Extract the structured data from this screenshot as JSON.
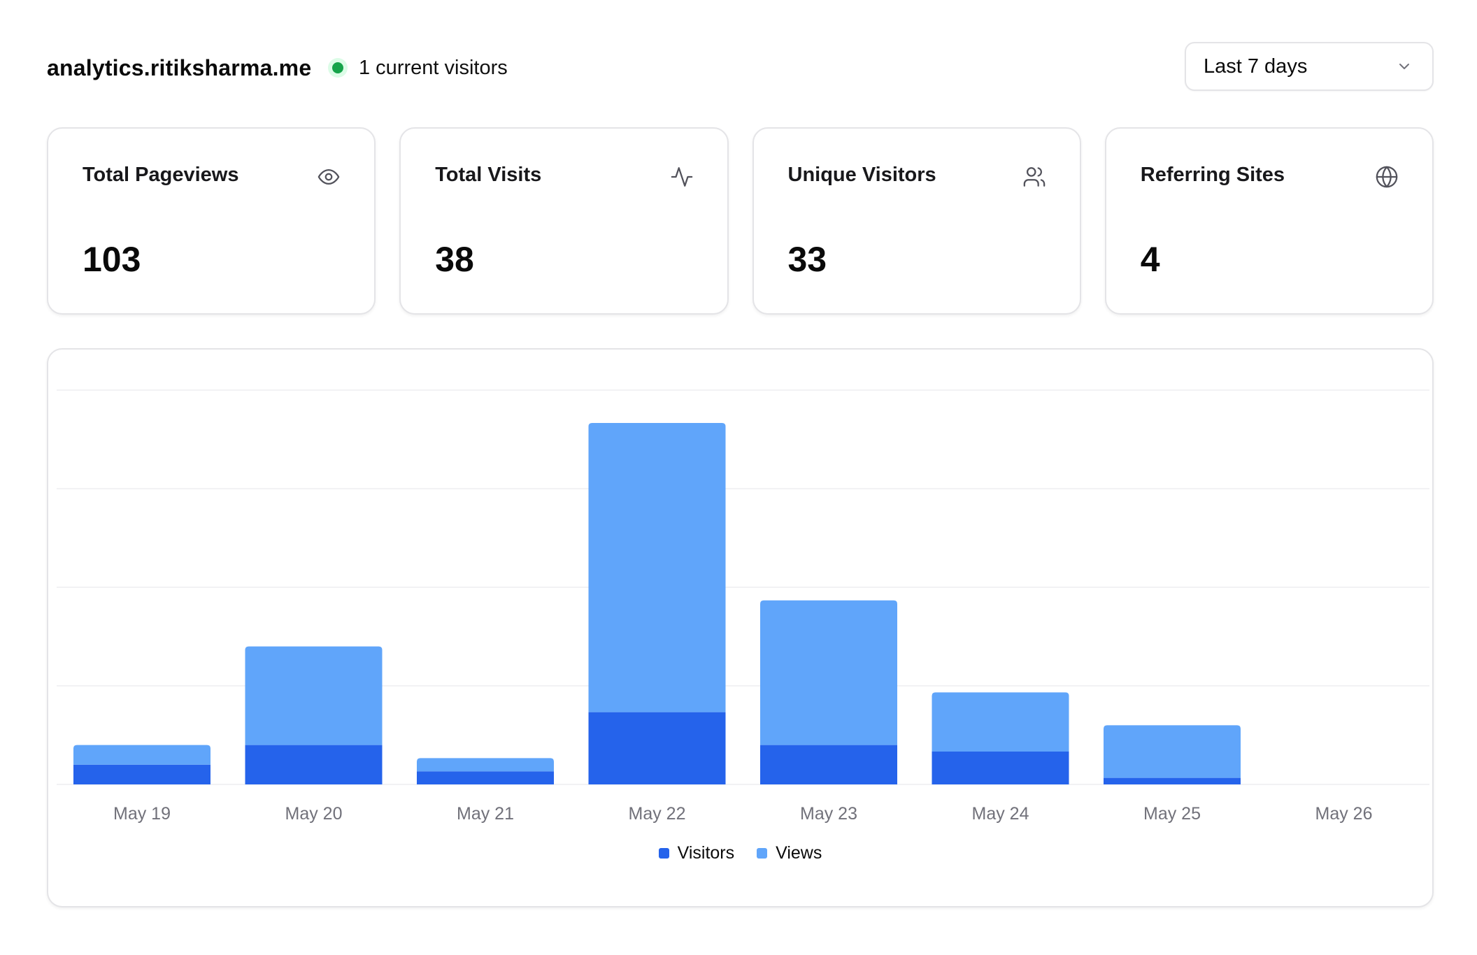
{
  "header": {
    "site_name": "analytics.ritiksharma.me",
    "live_visitors_text": "1 current visitors",
    "live_dot_color": "#16a34a",
    "range_select": {
      "value": "Last 7 days",
      "icon": "chevron-down-icon"
    }
  },
  "stats": [
    {
      "title": "Total Pageviews",
      "value": "103",
      "icon": "eye-icon"
    },
    {
      "title": "Total Visits",
      "value": "38",
      "icon": "activity-icon"
    },
    {
      "title": "Unique Visitors",
      "value": "33",
      "icon": "users-icon"
    },
    {
      "title": "Referring Sites",
      "value": "4",
      "icon": "globe-icon"
    }
  ],
  "chart_data": {
    "type": "bar",
    "stacked": true,
    "categories": [
      "May 19",
      "May 20",
      "May 21",
      "May 22",
      "May 23",
      "May 24",
      "May 25",
      "May 26"
    ],
    "series": [
      {
        "name": "Visitors",
        "color": "#2563eb",
        "values": [
          3,
          6,
          2,
          11,
          6,
          5,
          1,
          0
        ]
      },
      {
        "name": "Views",
        "color": "#60a5fa",
        "values": [
          3,
          15,
          2,
          44,
          22,
          9,
          8,
          0
        ]
      }
    ],
    "ylim": [
      0,
      60
    ],
    "grid": true,
    "legend_position": "bottom-center"
  }
}
